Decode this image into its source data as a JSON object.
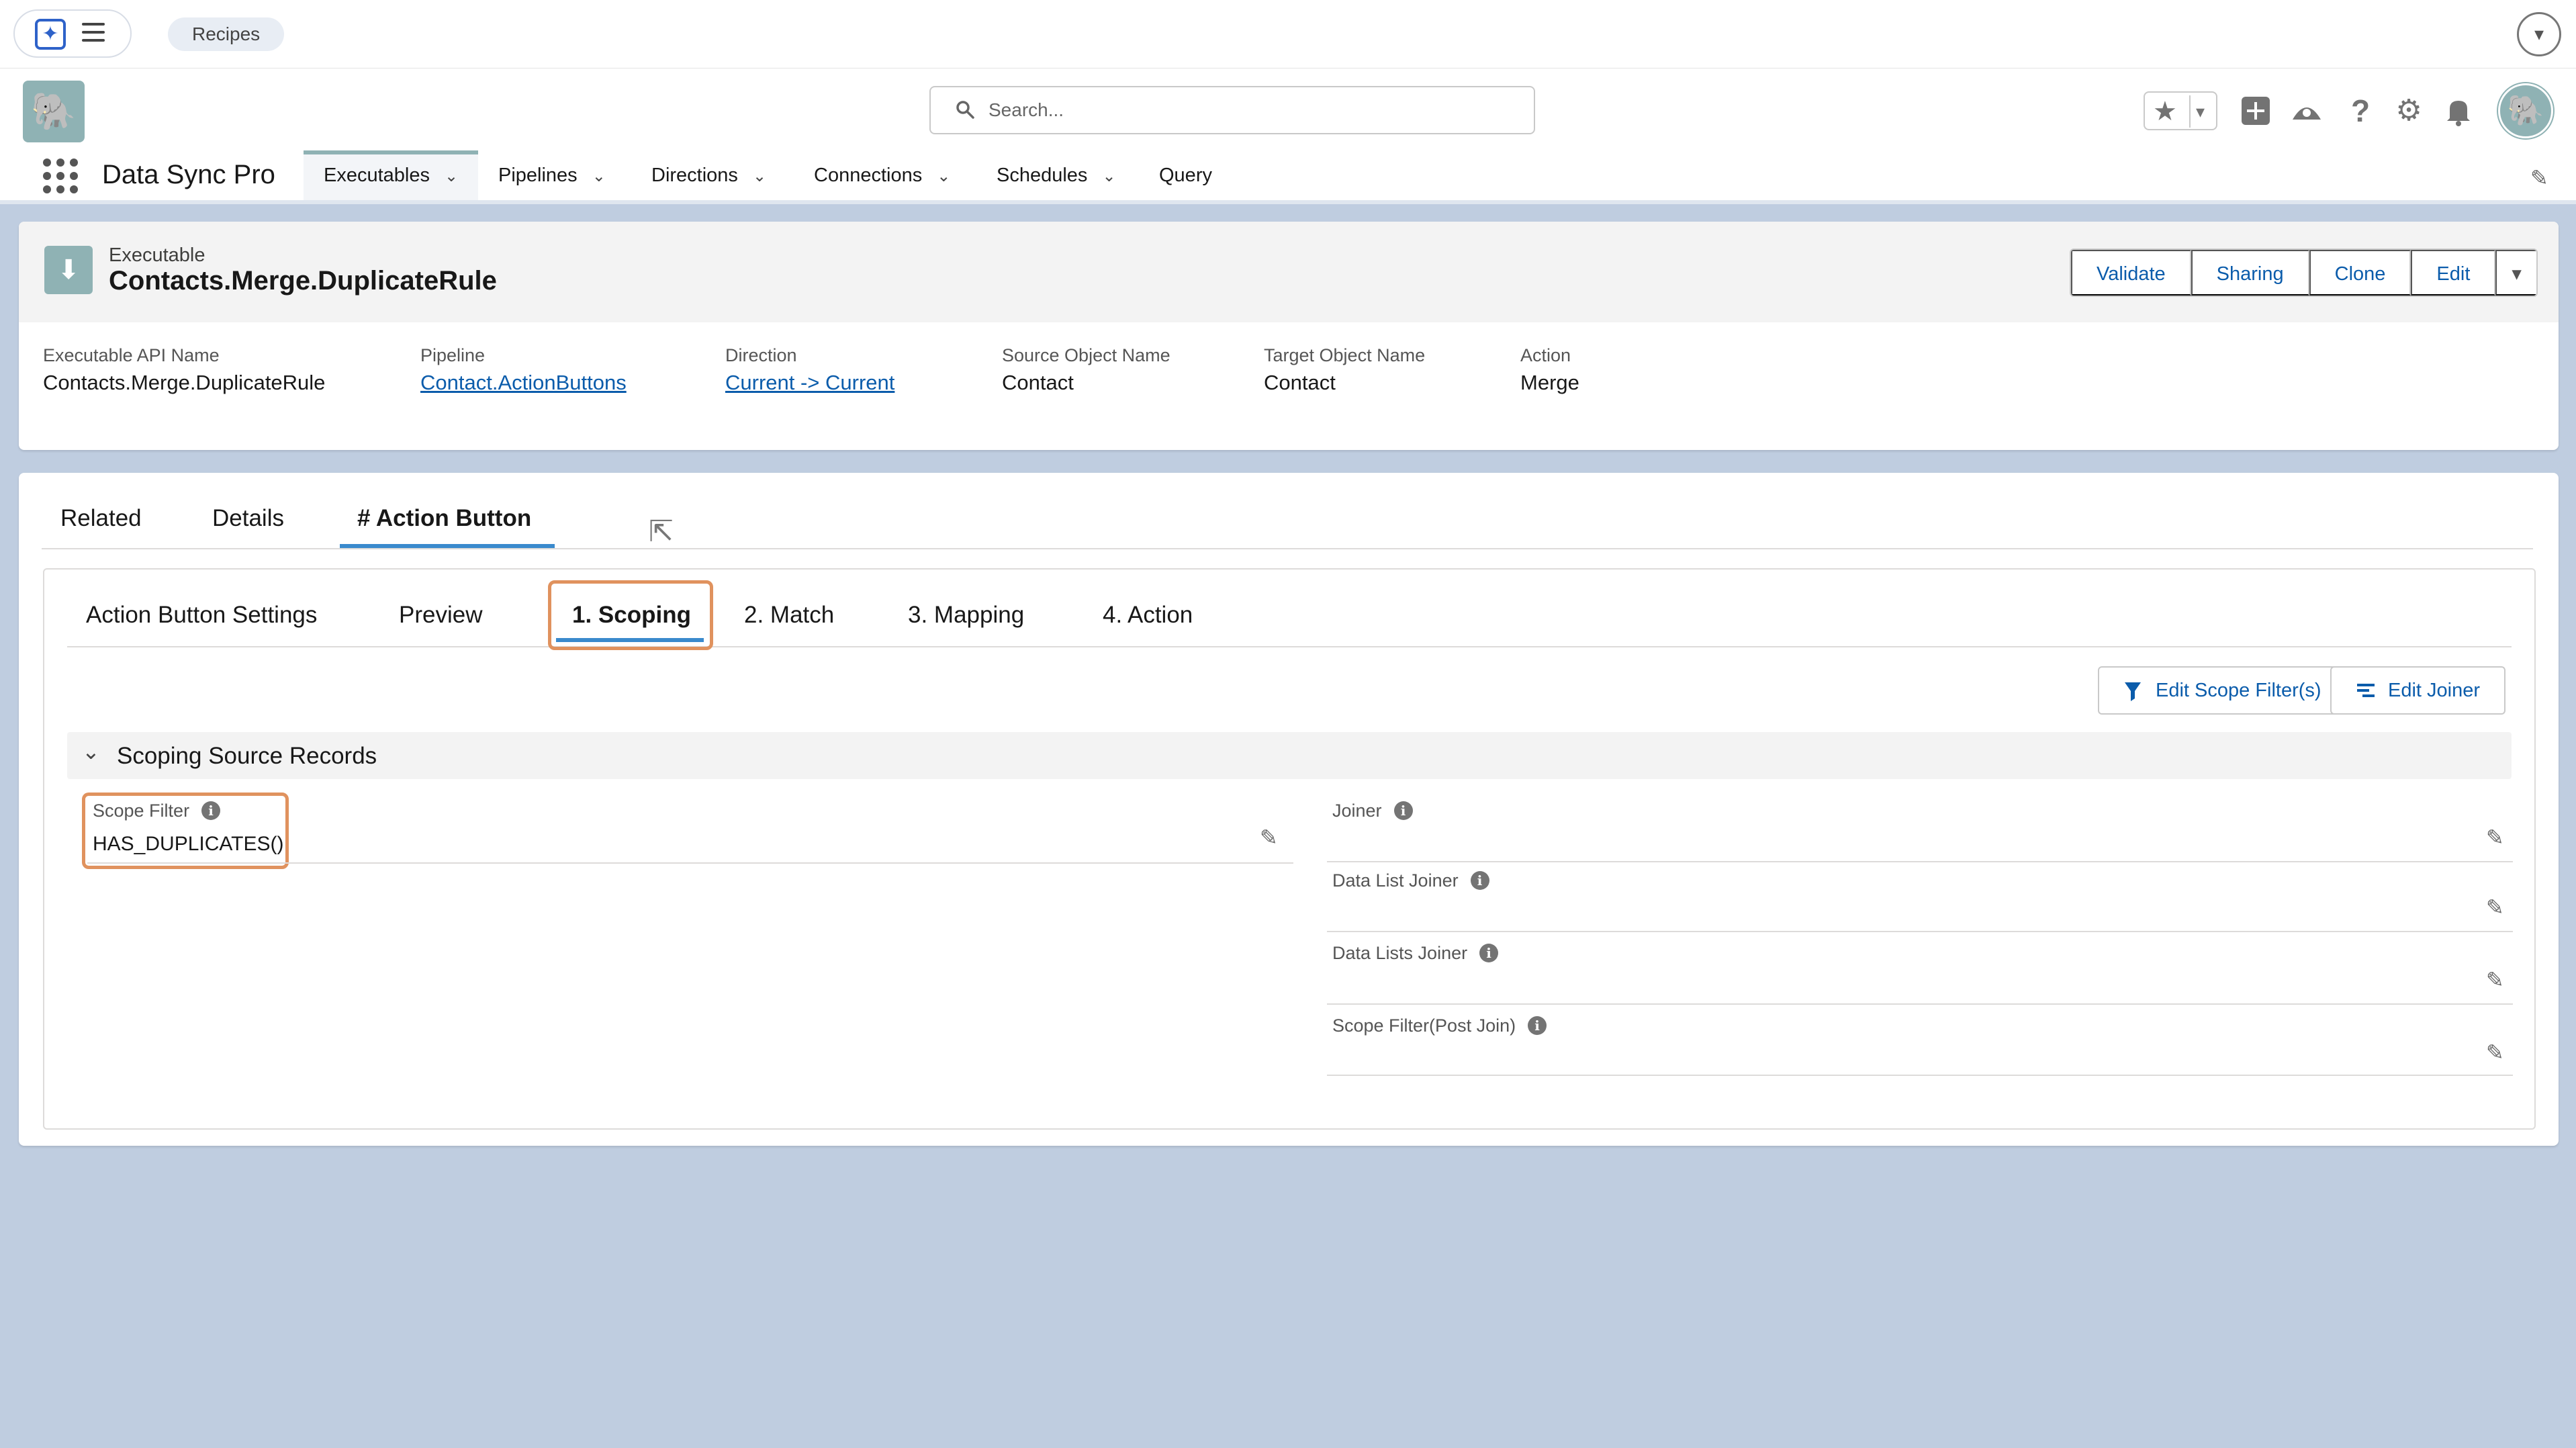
{
  "topbar": {
    "recipes_label": "Recipes"
  },
  "header": {
    "search_placeholder": "Search...",
    "app_name": "Data Sync Pro"
  },
  "nav": {
    "items": [
      {
        "label": "Executables",
        "chevron": "⌄"
      },
      {
        "label": "Pipelines",
        "chevron": "⌄"
      },
      {
        "label": "Directions",
        "chevron": "⌄"
      },
      {
        "label": "Connections",
        "chevron": "⌄"
      },
      {
        "label": "Schedules",
        "chevron": "⌄"
      },
      {
        "label": "Query"
      }
    ]
  },
  "record": {
    "object_label": "Executable",
    "title": "Contacts.Merge.DuplicateRule",
    "buttons": [
      "Validate",
      "Sharing",
      "Clone",
      "Edit"
    ],
    "fields": [
      {
        "label": "Executable API Name",
        "value": "Contacts.Merge.DuplicateRule"
      },
      {
        "label": "Pipeline",
        "value": "Contact.ActionButtons"
      },
      {
        "label": "Direction",
        "value": "Current -> Current"
      },
      {
        "label": "Source Object Name",
        "value": "Contact"
      },
      {
        "label": "Target Object Name",
        "value": "Contact"
      },
      {
        "label": "Action",
        "value": "Merge"
      }
    ]
  },
  "tabs": {
    "primary": [
      "Related",
      "Details",
      "# Action Button"
    ],
    "secondary": [
      "Action Button Settings",
      "Preview",
      "1. Scoping",
      "2. Match",
      "3. Mapping",
      "4. Action"
    ]
  },
  "scoping": {
    "edit_scope_filter_label": "Edit Scope Filter(s)",
    "edit_joiner_label": "Edit Joiner",
    "section_title": "Scoping Source Records",
    "scope_filter": {
      "label": "Scope Filter",
      "value": "HAS_DUPLICATES()"
    },
    "right_fields": [
      {
        "label": "Joiner"
      },
      {
        "label": "Data List Joiner"
      },
      {
        "label": "Data Lists Joiner"
      },
      {
        "label": "Scope Filter(Post Join)"
      }
    ]
  },
  "colors": {
    "accent": "#0b5cab",
    "brand": "#8fb2b4",
    "highlight": "#e0925e",
    "tab_active": "#3a8acd",
    "background": "#bfcde0"
  }
}
